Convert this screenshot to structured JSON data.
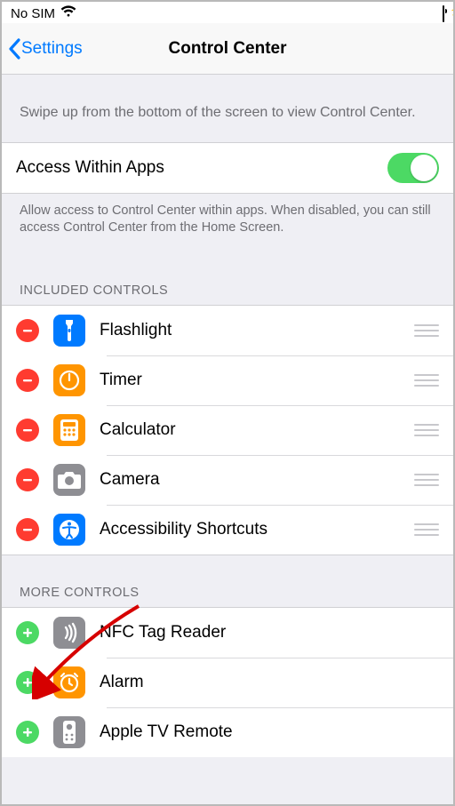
{
  "status": {
    "carrier": "No SIM"
  },
  "nav": {
    "back_label": "Settings",
    "title": "Control Center"
  },
  "intro_text": "Swipe up from the bottom of the screen to view Control Center.",
  "access": {
    "label": "Access Within Apps",
    "enabled": true,
    "footer": "Allow access to Control Center within apps. When disabled, you can still access Control Center from the Home Screen."
  },
  "included": {
    "header": "Included Controls",
    "items": [
      {
        "label": "Flashlight",
        "icon": "flashlight",
        "color": "#007aff"
      },
      {
        "label": "Timer",
        "icon": "timer",
        "color": "#ff9500"
      },
      {
        "label": "Calculator",
        "icon": "calculator",
        "color": "#ff9500"
      },
      {
        "label": "Camera",
        "icon": "camera",
        "color": "#8e8e93"
      },
      {
        "label": "Accessibility Shortcuts",
        "icon": "access",
        "color": "#007aff"
      }
    ]
  },
  "more": {
    "header": "More Controls",
    "items": [
      {
        "label": "NFC Tag Reader",
        "icon": "nfc",
        "color": "#8e8e93"
      },
      {
        "label": "Alarm",
        "icon": "alarm",
        "color": "#ff9500"
      },
      {
        "label": "Apple TV Remote",
        "icon": "remote",
        "color": "#8e8e93"
      }
    ]
  }
}
